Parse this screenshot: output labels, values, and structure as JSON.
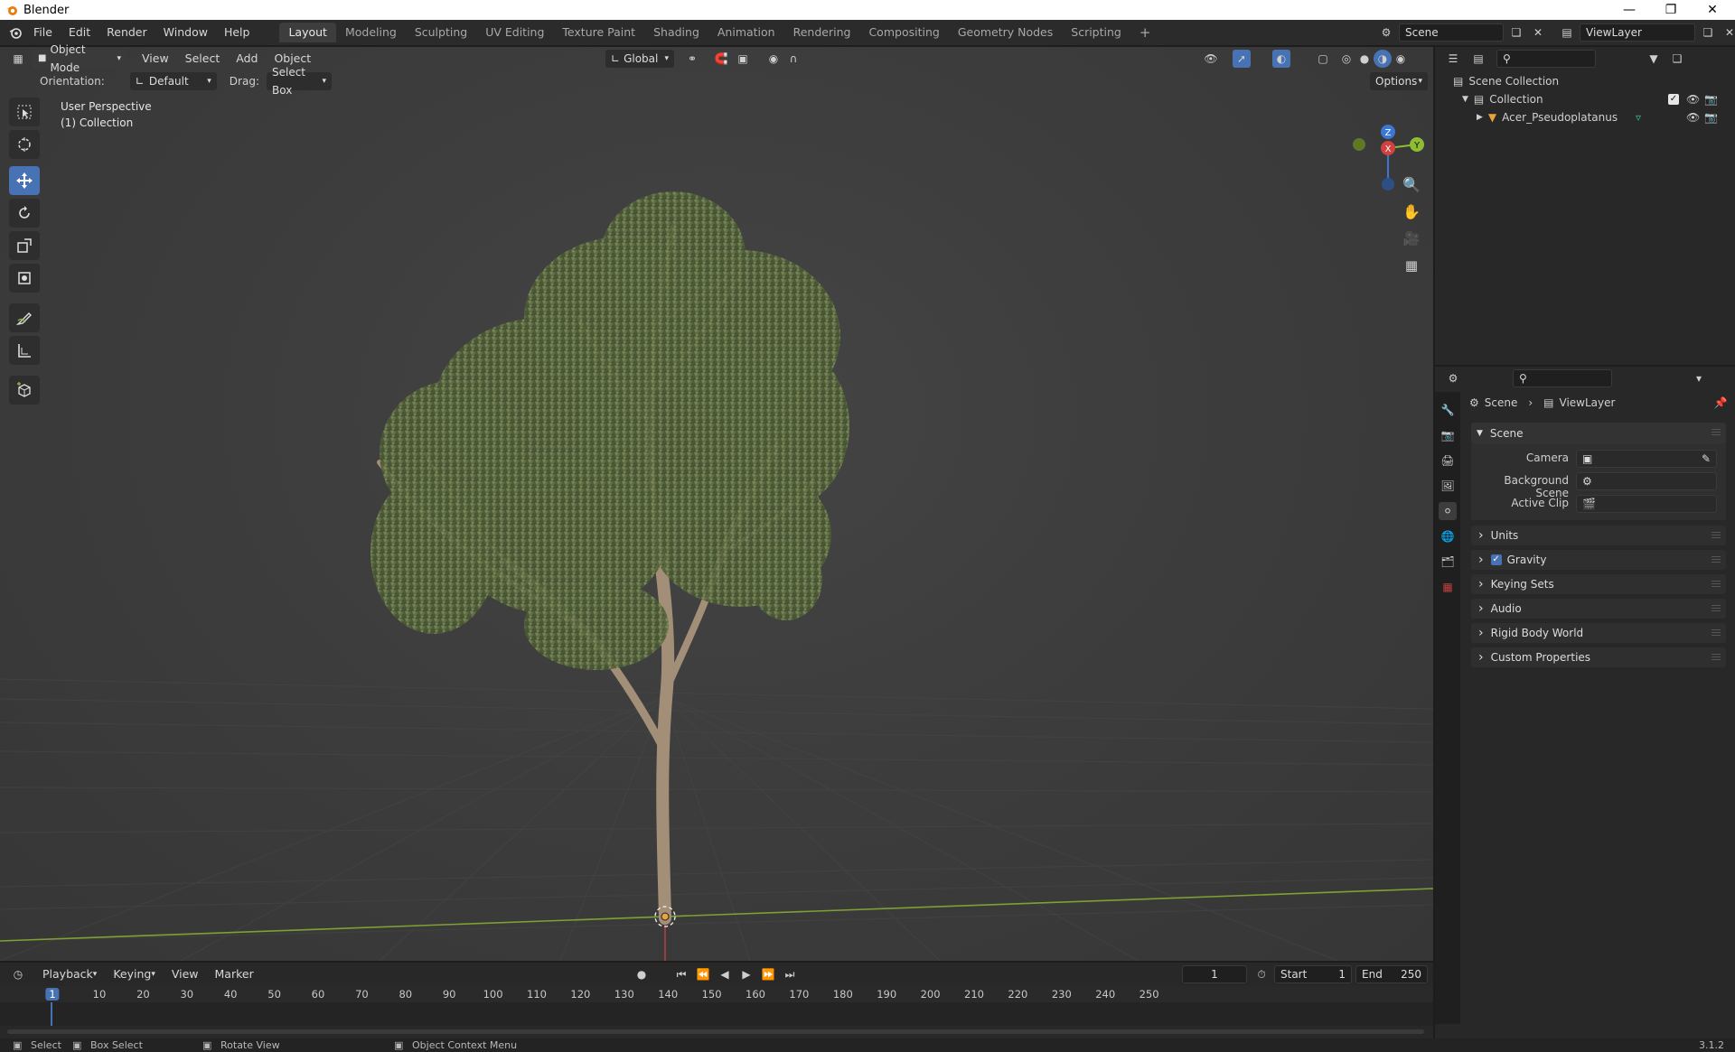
{
  "window": {
    "title": "Blender",
    "minimize_icon": "minimize-icon",
    "restore_icon": "restore-icon",
    "close_icon": "close-icon"
  },
  "topbar": {
    "menus": [
      "File",
      "Edit",
      "Render",
      "Window",
      "Help"
    ],
    "workspaces": [
      "Layout",
      "Modeling",
      "Sculpting",
      "UV Editing",
      "Texture Paint",
      "Shading",
      "Animation",
      "Rendering",
      "Compositing",
      "Geometry Nodes",
      "Scripting"
    ],
    "active_workspace": "Layout",
    "add_workspace": "+",
    "scene_name": "Scene",
    "view_layer_name": "ViewLayer"
  },
  "viewport": {
    "mode": "Object Mode",
    "menus": [
      "View",
      "Select",
      "Add",
      "Object"
    ],
    "transform_orientation": "Global",
    "orientation_label": "Orientation:",
    "orientation_value": "Default",
    "drag_label": "Drag:",
    "drag_value": "Select Box",
    "options_label": "Options",
    "overlay_line1": "User Perspective",
    "overlay_line2": "(1) Collection",
    "gizmo": {
      "z": "Z",
      "x": "X",
      "y": "Y"
    },
    "colors": {
      "x_axis": "#d0423f",
      "y_axis": "#8cbd32",
      "z_axis": "#3a77d6",
      "active_tool": "#4772b3"
    }
  },
  "tools": [
    "select-box-tool",
    "cursor-tool",
    "move-tool",
    "rotate-tool",
    "scale-tool",
    "transform-tool",
    "annotate-tool",
    "measure-tool",
    "add-cube-tool"
  ],
  "timeline": {
    "menus": [
      "Playback",
      "Keying",
      "View",
      "Marker"
    ],
    "current_frame": "1",
    "start_label": "Start",
    "start_value": "1",
    "end_label": "End",
    "end_value": "250",
    "ruler": [
      "1",
      "10",
      "20",
      "30",
      "40",
      "50",
      "60",
      "70",
      "80",
      "90",
      "100",
      "110",
      "120",
      "130",
      "140",
      "150",
      "160",
      "170",
      "180",
      "190",
      "200",
      "210",
      "220",
      "230",
      "240",
      "250"
    ]
  },
  "statusbar": {
    "select": "Select",
    "box_select": "Box Select",
    "rotate_view": "Rotate View",
    "context_menu": "Object Context Menu",
    "version": "3.1.2"
  },
  "outliner": {
    "root": "Scene Collection",
    "collection": "Collection",
    "object": "Acer_Pseudoplatanus"
  },
  "properties": {
    "breadcrumb_scene": "Scene",
    "breadcrumb_sep": "›",
    "breadcrumb_layer": "ViewLayer",
    "scene_panel": "Scene",
    "camera_label": "Camera",
    "background_label": "Background Scene",
    "clip_label": "Active Clip",
    "sections": [
      "Units",
      "Gravity",
      "Keying Sets",
      "Audio",
      "Rigid Body World",
      "Custom Properties"
    ],
    "gravity_checked": true
  }
}
